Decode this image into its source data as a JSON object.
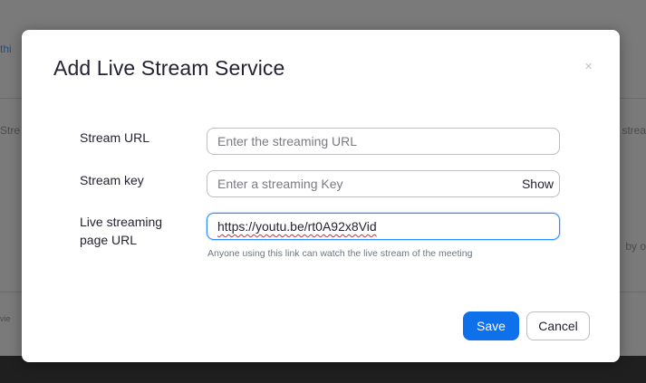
{
  "background": {
    "fragments": {
      "top_left": "thi",
      "mid_left": "Stre",
      "mid_right": "strea",
      "lower_right": "by o",
      "bottom_left": "vie"
    }
  },
  "modal": {
    "title": "Add Live Stream Service",
    "close_glyph": "×",
    "fields": {
      "stream_url": {
        "label": "Stream URL",
        "value": "",
        "placeholder": "Enter the streaming URL"
      },
      "stream_key": {
        "label": "Stream key",
        "value": "",
        "placeholder": "Enter a streaming Key",
        "show_label": "Show"
      },
      "page_url": {
        "label_line1": "Live streaming",
        "label_line2": "page URL",
        "value": "https://youtu.be/rt0A92x8Vid",
        "helper": "Anyone using this link can watch the live stream of the meeting"
      }
    },
    "buttons": {
      "save": "Save",
      "cancel": "Cancel"
    }
  },
  "colors": {
    "primary": "#0e71eb",
    "focus_border": "#2d8cff",
    "title_text": "#232333",
    "overlay": "#7a7a7a"
  },
  "icons": {
    "close": "close-icon"
  }
}
